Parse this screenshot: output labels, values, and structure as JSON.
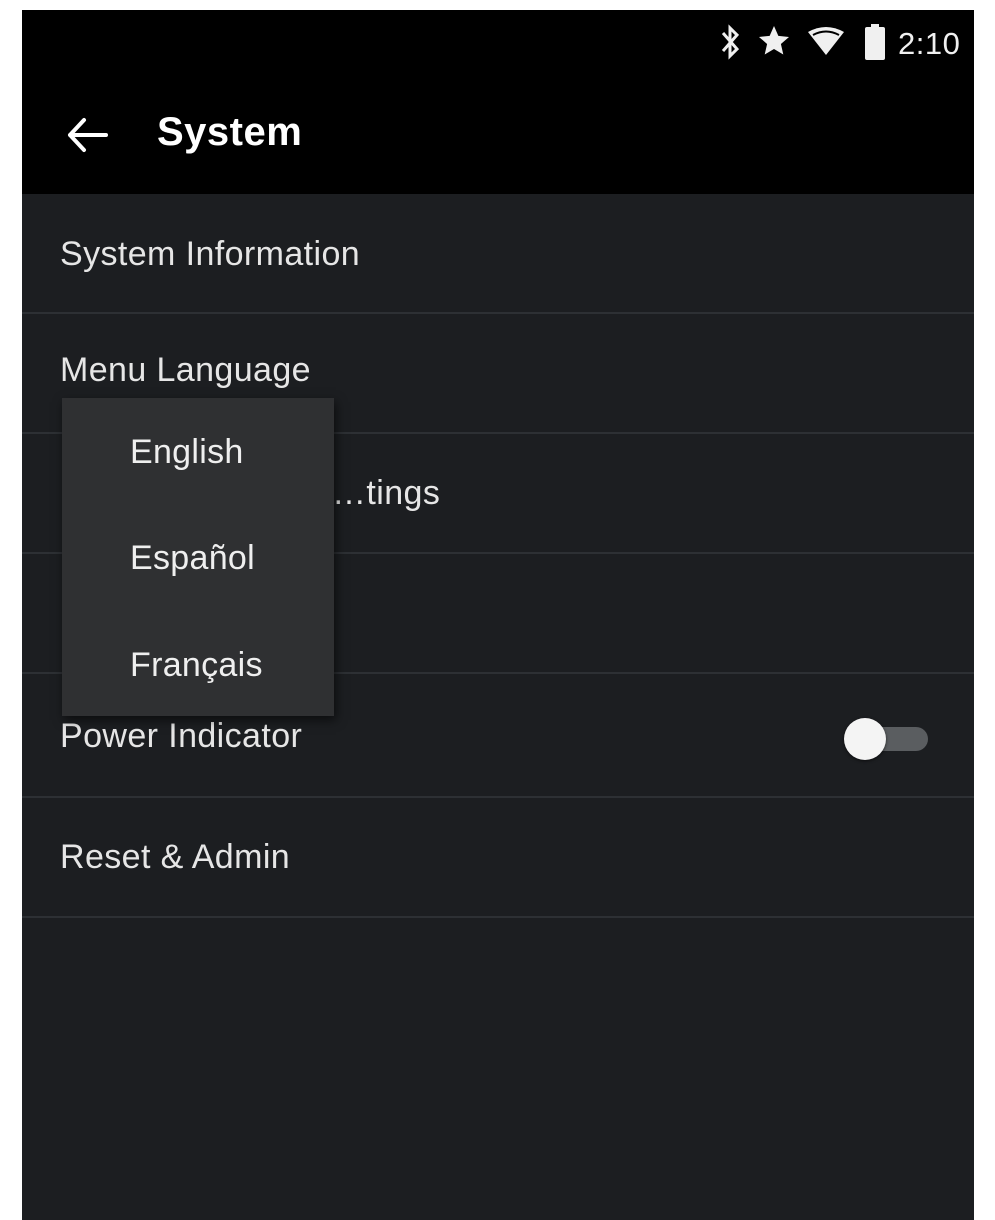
{
  "status_bar": {
    "time": "2:10",
    "icons": [
      "bluetooth-icon",
      "star-icon",
      "wifi-icon",
      "battery-icon"
    ]
  },
  "app_bar": {
    "back_icon": "arrow-left-icon",
    "title": "System"
  },
  "settings": {
    "items": [
      {
        "label": "System Information"
      },
      {
        "label": "Menu Language"
      },
      {
        "label": "…tings"
      },
      {
        "label": ""
      },
      {
        "label": "Power Indicator",
        "toggle_on": false
      },
      {
        "label": "Reset & Admin"
      }
    ]
  },
  "language_popup": {
    "options": [
      "English",
      "Español",
      "Français"
    ]
  },
  "colors": {
    "background": "#1c1e21",
    "bar": "#000000",
    "popup": "#2f3032",
    "text": "#e6e6e6"
  }
}
